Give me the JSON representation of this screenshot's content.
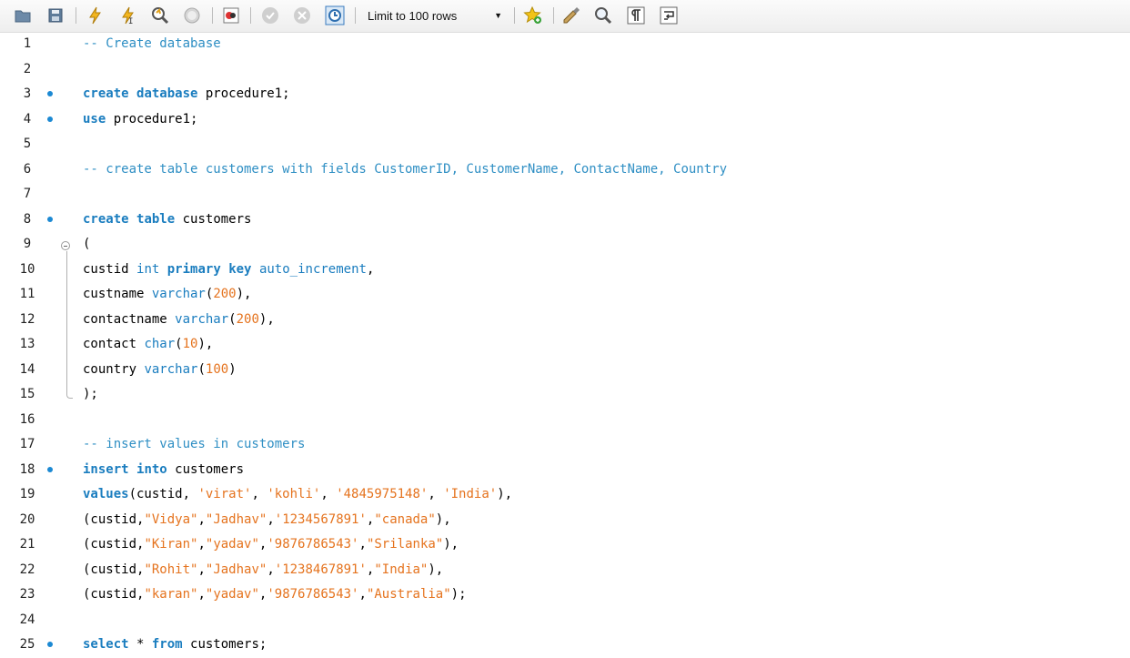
{
  "toolbar": {
    "icons": [
      "open-folder-icon",
      "save-icon",
      "execute-icon",
      "execute-statement-icon",
      "explain-icon",
      "stop-icon",
      "toggle-error-icon",
      "commit-icon",
      "rollback-icon",
      "autocommit-icon",
      "bookmark-icon",
      "beautify-icon",
      "find-icon",
      "invisible-chars-icon",
      "wrap-icon"
    ],
    "limit_label": "Limit to 100 rows"
  },
  "editor": {
    "lines": [
      {
        "num": "1",
        "dot": false,
        "tokens": [
          {
            "t": "-- Create database",
            "c": "cm"
          }
        ]
      },
      {
        "num": "2",
        "dot": false,
        "tokens": []
      },
      {
        "num": "3",
        "dot": true,
        "tokens": [
          {
            "t": "create",
            "c": "kw"
          },
          {
            "t": " "
          },
          {
            "t": "database",
            "c": "kw"
          },
          {
            "t": " procedure1;"
          }
        ]
      },
      {
        "num": "4",
        "dot": true,
        "tokens": [
          {
            "t": "use",
            "c": "kw"
          },
          {
            "t": " procedure1;"
          }
        ]
      },
      {
        "num": "5",
        "dot": false,
        "tokens": []
      },
      {
        "num": "6",
        "dot": false,
        "tokens": [
          {
            "t": "-- create table customers with fields CustomerID, CustomerName, ContactName, Country",
            "c": "cm"
          }
        ]
      },
      {
        "num": "7",
        "dot": false,
        "tokens": []
      },
      {
        "num": "8",
        "dot": true,
        "tokens": [
          {
            "t": "create",
            "c": "kw"
          },
          {
            "t": " "
          },
          {
            "t": "table",
            "c": "kw"
          },
          {
            "t": " customers"
          }
        ]
      },
      {
        "num": "9",
        "dot": false,
        "tokens": [
          {
            "t": "("
          }
        ]
      },
      {
        "num": "10",
        "dot": false,
        "tokens": [
          {
            "t": "custid "
          },
          {
            "t": "int",
            "c": "ty"
          },
          {
            "t": " "
          },
          {
            "t": "primary",
            "c": "kw"
          },
          {
            "t": " "
          },
          {
            "t": "key",
            "c": "kw"
          },
          {
            "t": " "
          },
          {
            "t": "auto_increment",
            "c": "ty"
          },
          {
            "t": ","
          }
        ]
      },
      {
        "num": "11",
        "dot": false,
        "tokens": [
          {
            "t": "custname "
          },
          {
            "t": "varchar",
            "c": "ty"
          },
          {
            "t": "("
          },
          {
            "t": "200",
            "c": "nm"
          },
          {
            "t": "),"
          }
        ]
      },
      {
        "num": "12",
        "dot": false,
        "tokens": [
          {
            "t": "contactname "
          },
          {
            "t": "varchar",
            "c": "ty"
          },
          {
            "t": "("
          },
          {
            "t": "200",
            "c": "nm"
          },
          {
            "t": "),"
          }
        ]
      },
      {
        "num": "13",
        "dot": false,
        "tokens": [
          {
            "t": "contact "
          },
          {
            "t": "char",
            "c": "ty"
          },
          {
            "t": "("
          },
          {
            "t": "10",
            "c": "nm"
          },
          {
            "t": "),"
          }
        ]
      },
      {
        "num": "14",
        "dot": false,
        "tokens": [
          {
            "t": "country "
          },
          {
            "t": "varchar",
            "c": "ty"
          },
          {
            "t": "("
          },
          {
            "t": "100",
            "c": "nm"
          },
          {
            "t": ")"
          }
        ]
      },
      {
        "num": "15",
        "dot": false,
        "tokens": [
          {
            "t": ");"
          }
        ]
      },
      {
        "num": "16",
        "dot": false,
        "tokens": []
      },
      {
        "num": "17",
        "dot": false,
        "tokens": [
          {
            "t": "-- insert values in customers",
            "c": "cm"
          }
        ]
      },
      {
        "num": "18",
        "dot": true,
        "tokens": [
          {
            "t": "insert",
            "c": "kw"
          },
          {
            "t": " "
          },
          {
            "t": "into",
            "c": "kw"
          },
          {
            "t": " customers"
          }
        ]
      },
      {
        "num": "19",
        "dot": false,
        "tokens": [
          {
            "t": "values",
            "c": "kw"
          },
          {
            "t": "(custid, "
          },
          {
            "t": "'virat'",
            "c": "st"
          },
          {
            "t": ", "
          },
          {
            "t": "'kohli'",
            "c": "st"
          },
          {
            "t": ", "
          },
          {
            "t": "'4845975148'",
            "c": "st"
          },
          {
            "t": ", "
          },
          {
            "t": "'India'",
            "c": "st"
          },
          {
            "t": "),"
          }
        ]
      },
      {
        "num": "20",
        "dot": false,
        "tokens": [
          {
            "t": "(custid,"
          },
          {
            "t": "\"Vidya\"",
            "c": "st"
          },
          {
            "t": ","
          },
          {
            "t": "\"Jadhav\"",
            "c": "st"
          },
          {
            "t": ","
          },
          {
            "t": "'1234567891'",
            "c": "st"
          },
          {
            "t": ","
          },
          {
            "t": "\"canada\"",
            "c": "st"
          },
          {
            "t": "),"
          }
        ]
      },
      {
        "num": "21",
        "dot": false,
        "tokens": [
          {
            "t": "(custid,"
          },
          {
            "t": "\"Kiran\"",
            "c": "st"
          },
          {
            "t": ","
          },
          {
            "t": "\"yadav\"",
            "c": "st"
          },
          {
            "t": ","
          },
          {
            "t": "'9876786543'",
            "c": "st"
          },
          {
            "t": ","
          },
          {
            "t": "\"Srilanka\"",
            "c": "st"
          },
          {
            "t": "),"
          }
        ]
      },
      {
        "num": "22",
        "dot": false,
        "tokens": [
          {
            "t": "(custid,"
          },
          {
            "t": "\"Rohit\"",
            "c": "st"
          },
          {
            "t": ","
          },
          {
            "t": "\"Jadhav\"",
            "c": "st"
          },
          {
            "t": ","
          },
          {
            "t": "'1238467891'",
            "c": "st"
          },
          {
            "t": ","
          },
          {
            "t": "\"India\"",
            "c": "st"
          },
          {
            "t": "),"
          }
        ]
      },
      {
        "num": "23",
        "dot": false,
        "tokens": [
          {
            "t": "(custid,"
          },
          {
            "t": "\"karan\"",
            "c": "st"
          },
          {
            "t": ","
          },
          {
            "t": "\"yadav\"",
            "c": "st"
          },
          {
            "t": ","
          },
          {
            "t": "'9876786543'",
            "c": "st"
          },
          {
            "t": ","
          },
          {
            "t": "\"Australia\"",
            "c": "st"
          },
          {
            "t": ");"
          }
        ]
      },
      {
        "num": "24",
        "dot": false,
        "tokens": []
      },
      {
        "num": "25",
        "dot": true,
        "tokens": [
          {
            "t": "select",
            "c": "kw"
          },
          {
            "t": " * "
          },
          {
            "t": "from",
            "c": "kw"
          },
          {
            "t": " customers;"
          }
        ]
      }
    ]
  }
}
